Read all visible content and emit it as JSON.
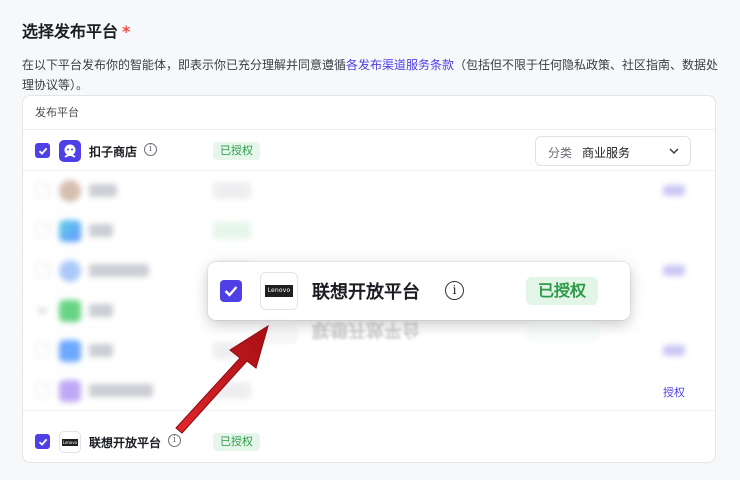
{
  "section": {
    "title": "选择发布平台",
    "required_mark": "*",
    "desc_before": "在以下平台发布你的智能体，即表示你已充分理解并同意遵循",
    "desc_link": "各发布渠道服务条款",
    "desc_after": "（包括但不限于任何隐私政策、社区指南、数据处理协议等）。"
  },
  "table": {
    "header": "发布平台",
    "rows": [
      {
        "name": "扣子商店",
        "checked": true,
        "badge": "已授权",
        "category_label": "分类",
        "category_value": "商业服务",
        "icon": "coze-store-icon"
      },
      {
        "name": "联想开放平台",
        "checked": true,
        "badge": "已授权",
        "icon": "lenovo-logo"
      }
    ],
    "feishu_multidim_auth_link": "授权",
    "lenovo_logo_text": "Lenovo"
  },
  "zoom_callout": {
    "name": "联想开放平台",
    "badge": "已授权",
    "info_glyph": "i"
  },
  "colors": {
    "accent": "#4e40e5",
    "badge_bg": "#e6f6ea",
    "badge_text": "#2c9a48",
    "arrow": "#c8171d",
    "required": "#f54a45"
  }
}
